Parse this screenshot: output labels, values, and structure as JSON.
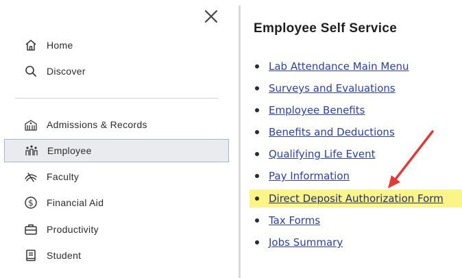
{
  "sidebar": {
    "close_label": "✕",
    "top_items": [
      {
        "label": "Home",
        "icon": "home-icon"
      },
      {
        "label": "Discover",
        "icon": "search-icon"
      }
    ],
    "items": [
      {
        "label": "Admissions & Records",
        "icon": "admissions-icon"
      },
      {
        "label": "Employee",
        "icon": "employee-icon",
        "active": true
      },
      {
        "label": "Faculty",
        "icon": "faculty-icon"
      },
      {
        "label": "Financial Aid",
        "icon": "dollar-icon"
      },
      {
        "label": "Productivity",
        "icon": "briefcase-icon"
      },
      {
        "label": "Student",
        "icon": "book-icon"
      }
    ]
  },
  "main": {
    "title": "Employee Self Service",
    "links": [
      "Lab Attendance Main Menu",
      "Surveys and Evaluations",
      "Employee Benefits",
      "Benefits and Deductions",
      "Qualifying Life Event",
      "Pay Information",
      "Direct Deposit Authorization Form",
      "Tax Forms",
      "Jobs Summary"
    ],
    "highlighted_link": "Direct Deposit Authorization Form"
  },
  "colors": {
    "link": "#2b3fa6",
    "highlight": "#fbf587",
    "arrow": "#e53935",
    "active_bg": "#e9ebee",
    "active_border": "#9fb6d0"
  }
}
